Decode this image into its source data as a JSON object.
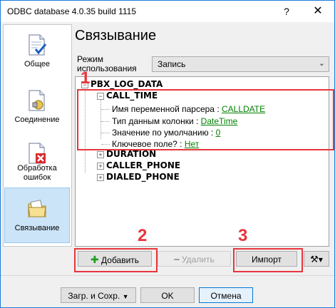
{
  "window": {
    "title": "ODBC database 4.0.35 build 1115",
    "help_label": "?",
    "close_label": "✕"
  },
  "sidebar": {
    "items": [
      {
        "label": "Общее",
        "icon": "document-check-icon"
      },
      {
        "label": "Соединение",
        "icon": "connection-document-icon"
      },
      {
        "label": "Обработка ошибок",
        "label_line1": "Обработка",
        "label_line2": "ошибок",
        "icon": "error-document-icon"
      },
      {
        "label": "Связывание",
        "icon": "binding-folder-icon",
        "active": true
      }
    ]
  },
  "main": {
    "heading": "Связывание",
    "mode_label_line1": "Режим",
    "mode_label_line2": "использования",
    "mode_value": "Запись"
  },
  "tree": {
    "root": "PBX_LOG_DATA",
    "call_time": {
      "name": "CALL_TIME",
      "props": [
        {
          "label": "Имя переменной парсера : ",
          "value": "CALLDATE"
        },
        {
          "label": "Тип данным колонки : ",
          "value": "DateTime"
        },
        {
          "label": "Значение по умолчанию : ",
          "value": "0"
        },
        {
          "label": "Ключевое поле? : ",
          "value": "Нет"
        }
      ]
    },
    "others": [
      "DURATION",
      "CALLER_PHONE",
      "DIALED_PHONE"
    ]
  },
  "annotations": {
    "n1": "1",
    "n2": "2",
    "n3": "3"
  },
  "buttons": {
    "add": "Добавить",
    "delete": "Удалить",
    "import": "Импорт",
    "tools_arrow": "▾"
  },
  "footer": {
    "load_save": "Загр. и Сохр.",
    "ok": "OK",
    "cancel": "Отмена"
  },
  "colors": {
    "annotation": "#e8353b",
    "link": "#008000",
    "accent": "#0078d7"
  }
}
